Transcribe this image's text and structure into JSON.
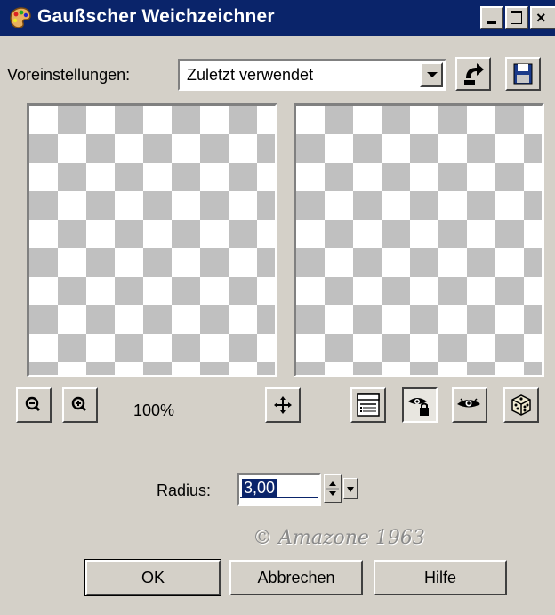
{
  "window": {
    "title": "Gaußscher Weichzeichner",
    "controls": {
      "minimize": "minimize",
      "maximize": "maximize",
      "close": "×"
    }
  },
  "presets": {
    "label": "Voreinstellungen:",
    "selected": "Zuletzt verwendet"
  },
  "preview": {
    "zoom": "100%",
    "pattern": "transparent-checkerboard"
  },
  "settings": {
    "radius_label": "Radius:",
    "radius_value": "3,00"
  },
  "watermark": "© Amazone 1963",
  "buttons": {
    "ok": "OK",
    "cancel": "Abbrechen",
    "help": "Hilfe"
  },
  "colors": {
    "titlebar": "#0a246a",
    "dialog_bg": "#d4d0c8",
    "selection": "#0a246a"
  }
}
